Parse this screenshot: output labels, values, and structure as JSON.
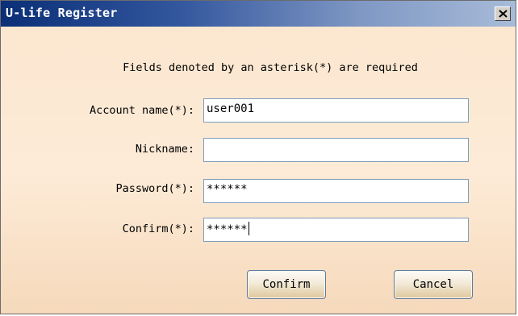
{
  "window": {
    "title": "U-life Register",
    "close_symbol": "close-icon"
  },
  "form": {
    "notice": "Fields denoted by an asterisk(*) are required",
    "fields": [
      {
        "label": "Account name(*):",
        "value": "user001",
        "type": "text"
      },
      {
        "label": "Nickname:",
        "value": "",
        "type": "text"
      },
      {
        "label": "Password(*):",
        "value": "******",
        "type": "password"
      },
      {
        "label": "Confirm(*):",
        "value": "******",
        "type": "password",
        "focused": true
      }
    ]
  },
  "buttons": {
    "confirm_label": "Confirm",
    "cancel_label": "Cancel"
  },
  "colors": {
    "titlebar_start": "#0a2f77",
    "titlebar_end": "#a8bbd8",
    "background": "#fdebd7",
    "input_border": "#7f9db9"
  }
}
